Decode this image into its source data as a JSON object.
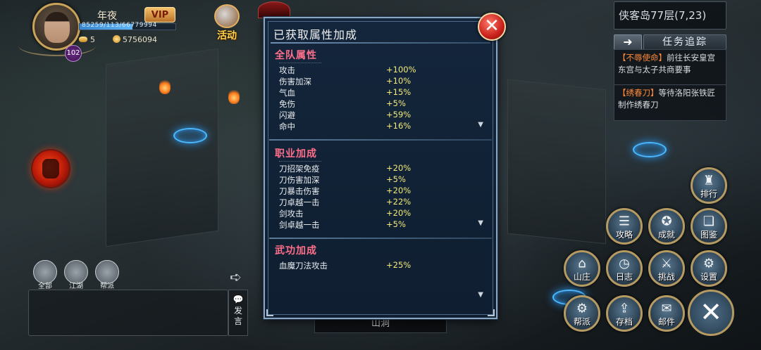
{
  "player": {
    "name": "年夜",
    "vip": "VIP",
    "hp_text": "85259/113/66779994",
    "hp_ratio": 0.55,
    "level": "102",
    "gold": "5",
    "silver": "5756094"
  },
  "activity": {
    "label": "活动"
  },
  "location": {
    "text": "侠客岛77层(7,23)"
  },
  "quest_panel": {
    "track_label": "任务追踪",
    "quests": [
      {
        "tag": "【不辱使命】",
        "text": "前往长安皇宫东宫与太子共商要事"
      },
      {
        "tag": "【绣春刀】",
        "text": "等待洛阳张铁匠制作绣春刀"
      }
    ]
  },
  "chat": {
    "channels": [
      {
        "label": "全部"
      },
      {
        "label": "江湖"
      },
      {
        "label": "帮派"
      }
    ],
    "speak_label": "发言"
  },
  "scene_label": "山洞",
  "modal": {
    "title": "已获取属性加成",
    "sections": [
      {
        "title": "全队属性",
        "rows": [
          {
            "name": "攻击",
            "value": "+100%"
          },
          {
            "name": "伤害加深",
            "value": "+10%"
          },
          {
            "name": "气血",
            "value": "+15%"
          },
          {
            "name": "免伤",
            "value": "+5%"
          },
          {
            "name": "闪避",
            "value": "+59%"
          },
          {
            "name": "命中",
            "value": "+16%"
          }
        ]
      },
      {
        "title": "职业加成",
        "rows": [
          {
            "name": "刀招架免疫",
            "value": "+20%"
          },
          {
            "name": "刀伤害加深",
            "value": "+5%"
          },
          {
            "name": "刀暴击伤害",
            "value": "+20%"
          },
          {
            "name": "刀卓越一击",
            "value": "+22%"
          },
          {
            "name": "剑攻击",
            "value": "+20%"
          },
          {
            "name": "剑卓越一击",
            "value": "+5%"
          }
        ]
      },
      {
        "title": "武功加成",
        "rows": [
          {
            "name": "血魔刀法攻击",
            "value": "+25%"
          }
        ]
      }
    ]
  },
  "function_buttons": {
    "rank": "排行",
    "strategy": "攻略",
    "achievement": "成就",
    "handbook": "图鉴",
    "manor": "山庄",
    "journal": "日志",
    "challenge": "挑战",
    "settings": "设置",
    "guild": "帮派",
    "save": "存档",
    "mail": "邮件"
  },
  "colors": {
    "section_title": "#ff6f8a",
    "value": "#f3ea7a",
    "close_button": "#c8201a",
    "vip": "#f3c16a"
  }
}
